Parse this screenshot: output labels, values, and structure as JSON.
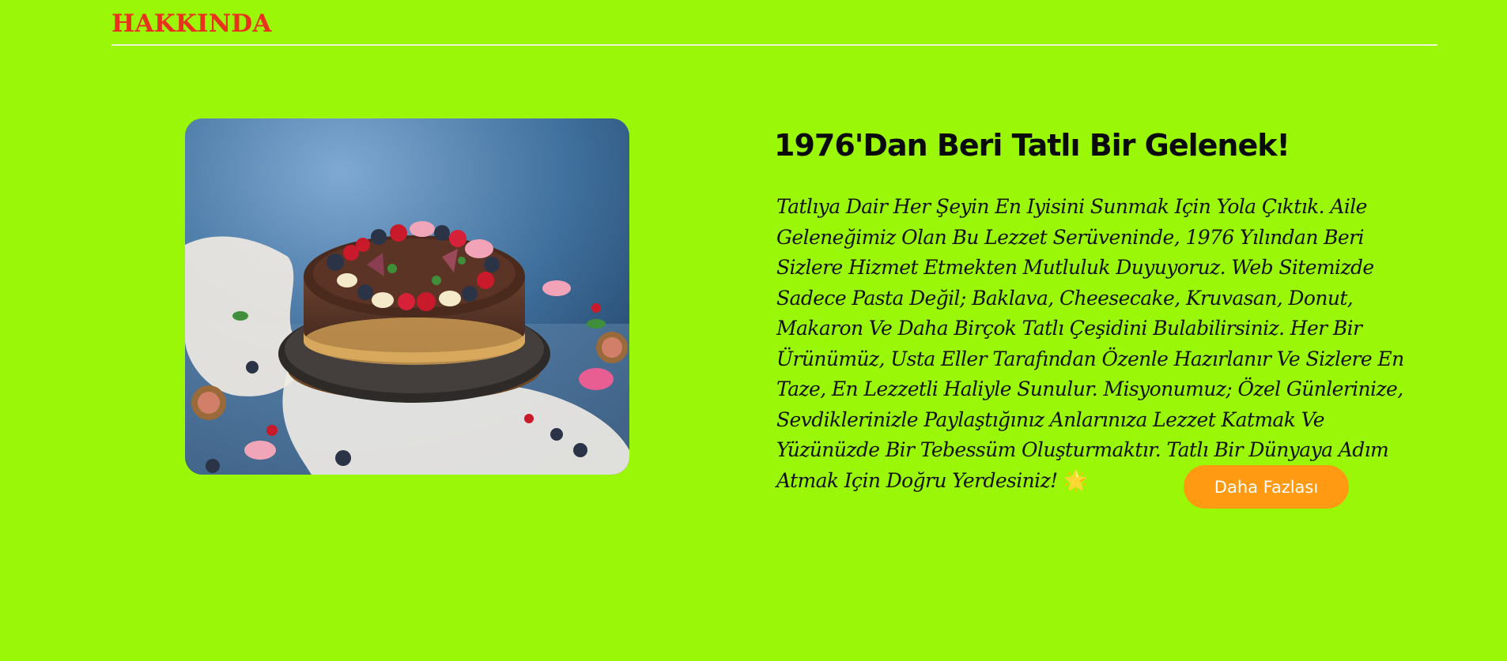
{
  "section": {
    "title": "HAKKINDA"
  },
  "about": {
    "heading": "1976'Dan Beri Tatlı Bir Gelenek!",
    "body": "Tatlıya Dair Her Şeyin En Iyisini Sunmak Için Yola Çıktık. Aile Geleneğimiz Olan Bu Lezzet Serüveninde, 1976 Yılından Beri Sizlere Hizmet Etmekten Mutluluk Duyuyoruz. Web Sitemizde Sadece Pasta Değil; Baklava, Cheesecake, Kruvasan, Donut, Makaron Ve Daha Birçok Tatlı Çeşidini Bulabilirsiniz. Her Bir Ürünümüz, Usta Eller Tarafından Özenle Hazırlanır Ve Sizlere En Taze, En Lezzetli Haliyle Sunulur. Misyonumuz; Özel Günlerinize, Sevdiklerinizle Paylaştığınız Anlarınıza Lezzet Katmak Ve Yüzünüzde Bir Tebessüm Oluşturmaktır. Tatlı Bir Dünyaya Adım Atmak Için Doğru Yerdesiniz!",
    "emoji": "🌟",
    "button_label": "Daha Fazlası",
    "image_icon": "cake-photo"
  },
  "colors": {
    "background": "#9af708",
    "title": "#e8321e",
    "button": "#ff9a12",
    "divider": "#eef7d9"
  }
}
